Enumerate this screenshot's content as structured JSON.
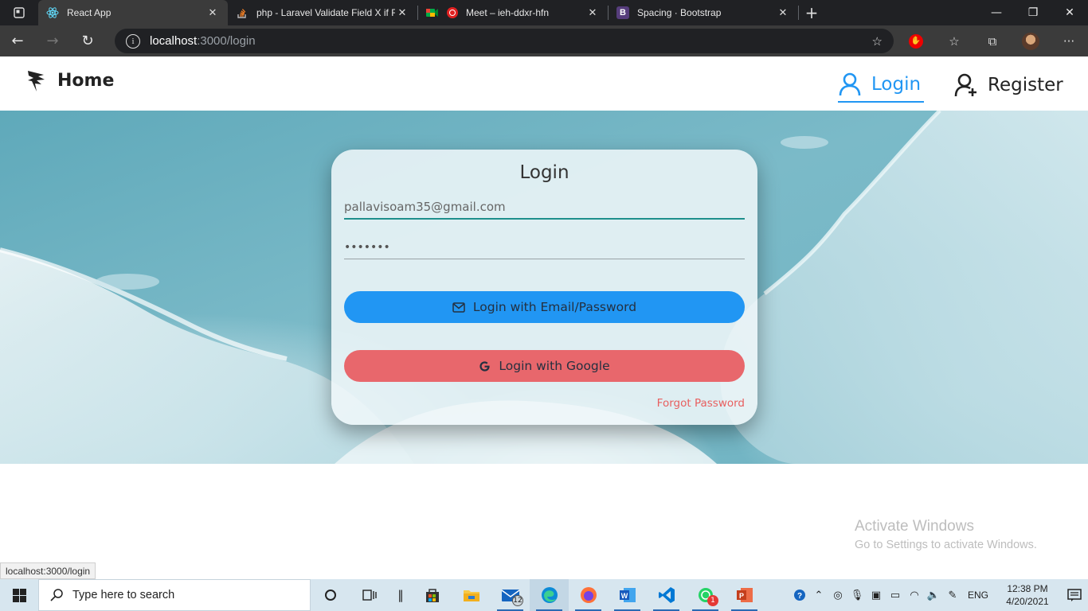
{
  "browser": {
    "tabs": [
      {
        "title": "React App",
        "active": true,
        "favicon": "react-icon"
      },
      {
        "title": "php - Laravel Validate Field X if F",
        "active": false,
        "favicon": "stackoverflow-icon"
      },
      {
        "title": "Meet – ieh-ddxr-hfn",
        "active": false,
        "favicon": "meet-icon"
      },
      {
        "title": "Spacing · Bootstrap",
        "active": false,
        "favicon": "bootstrap-icon"
      }
    ],
    "url_host": "localhost",
    "url_path": ":3000/login"
  },
  "navbar": {
    "brand_label": "Home",
    "login_label": "Login",
    "register_label": "Register",
    "active_link": "Login",
    "accent_color": "#2196f3"
  },
  "login_card": {
    "title": "Login",
    "email_value": "pallavisoam35@gmail.com",
    "password_value": "•••••••",
    "email_button_label": "Login with Email/Password",
    "google_button_label": "Login with Google",
    "forgot_label": "Forgot Password",
    "email_button_color": "#2196f3",
    "google_button_color": "#e8676c"
  },
  "watermark": {
    "line1": "Activate Windows",
    "line2": "Go to Settings to activate Windows."
  },
  "status_link": "localhost:3000/login",
  "taskbar": {
    "search_placeholder": "Type here to search",
    "mail_badge": "12",
    "whatsapp_badge": "1",
    "language": "ENG",
    "time": "12:38 PM",
    "date": "4/20/2021"
  }
}
